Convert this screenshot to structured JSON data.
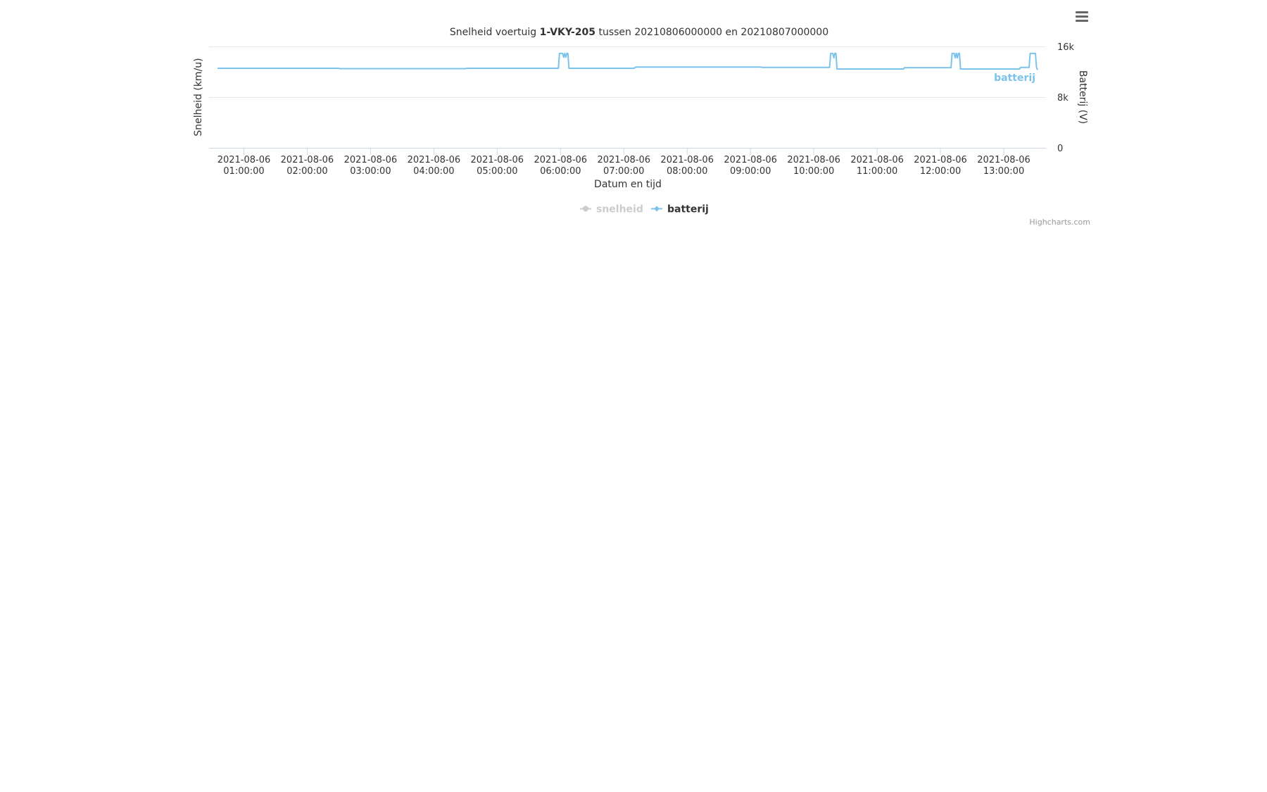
{
  "chart_data": {
    "type": "line",
    "title_prefix": "Snelheid voertuig ",
    "title_vehicle": "1-VKY-205",
    "title_suffix": " tussen 20210806000000 en 20210807000000",
    "xlabel": "Datum en tijd",
    "ylabel_left": "Snelheid (km/u)",
    "ylabel_right": "Batterij (V)",
    "x_range": [
      "2021-08-06 00:27:00",
      "2021-08-06 13:40:00"
    ],
    "x_ticks": [
      {
        "date": "2021-08-06",
        "time": "01:00:00"
      },
      {
        "date": "2021-08-06",
        "time": "02:00:00"
      },
      {
        "date": "2021-08-06",
        "time": "03:00:00"
      },
      {
        "date": "2021-08-06",
        "time": "04:00:00"
      },
      {
        "date": "2021-08-06",
        "time": "05:00:00"
      },
      {
        "date": "2021-08-06",
        "time": "06:00:00"
      },
      {
        "date": "2021-08-06",
        "time": "07:00:00"
      },
      {
        "date": "2021-08-06",
        "time": "08:00:00"
      },
      {
        "date": "2021-08-06",
        "time": "09:00:00"
      },
      {
        "date": "2021-08-06",
        "time": "10:00:00"
      },
      {
        "date": "2021-08-06",
        "time": "11:00:00"
      },
      {
        "date": "2021-08-06",
        "time": "12:00:00"
      },
      {
        "date": "2021-08-06",
        "time": "13:00:00"
      }
    ],
    "y_right": {
      "min": 0,
      "max": 16000,
      "ticks": [
        "0",
        "8k",
        "16k"
      ],
      "grid": true
    },
    "series": [
      {
        "name": "snelheid",
        "color": "#cccccc",
        "visible": false,
        "values": []
      },
      {
        "name": "batterij",
        "color": "#7cc3ec",
        "visible": true,
        "end_label": "batterij",
        "points": [
          [
            "2021-08-06 00:35:00",
            12550
          ],
          [
            "2021-08-06 02:30:00",
            12550
          ],
          [
            "2021-08-06 02:31:00",
            12500
          ],
          [
            "2021-08-06 04:30:00",
            12500
          ],
          [
            "2021-08-06 04:31:00",
            12550
          ],
          [
            "2021-08-06 05:58:00",
            12550
          ],
          [
            "2021-08-06 05:59:00",
            14900
          ],
          [
            "2021-08-06 06:02:00",
            14900
          ],
          [
            "2021-08-06 06:03:00",
            14300
          ],
          [
            "2021-08-06 06:04:00",
            14900
          ],
          [
            "2021-08-06 06:05:00",
            14300
          ],
          [
            "2021-08-06 06:06:00",
            14900
          ],
          [
            "2021-08-06 06:07:00",
            14900
          ],
          [
            "2021-08-06 06:08:00",
            12550
          ],
          [
            "2021-08-06 07:10:00",
            12550
          ],
          [
            "2021-08-06 07:11:00",
            12750
          ],
          [
            "2021-08-06 09:10:00",
            12750
          ],
          [
            "2021-08-06 09:11:00",
            12700
          ],
          [
            "2021-08-06 10:15:00",
            12700
          ],
          [
            "2021-08-06 10:16:00",
            14900
          ],
          [
            "2021-08-06 10:18:00",
            14900
          ],
          [
            "2021-08-06 10:19:00",
            14200
          ],
          [
            "2021-08-06 10:20:00",
            14900
          ],
          [
            "2021-08-06 10:21:00",
            14900
          ],
          [
            "2021-08-06 10:22:00",
            12450
          ],
          [
            "2021-08-06 11:25:00",
            12450
          ],
          [
            "2021-08-06 11:26:00",
            12650
          ],
          [
            "2021-08-06 12:10:00",
            12650
          ],
          [
            "2021-08-06 12:11:00",
            14900
          ],
          [
            "2021-08-06 12:13:00",
            14900
          ],
          [
            "2021-08-06 12:14:00",
            14200
          ],
          [
            "2021-08-06 12:15:00",
            14900
          ],
          [
            "2021-08-06 12:16:00",
            14200
          ],
          [
            "2021-08-06 12:17:00",
            14900
          ],
          [
            "2021-08-06 12:18:00",
            14900
          ],
          [
            "2021-08-06 12:19:00",
            12450
          ],
          [
            "2021-08-06 13:15:00",
            12450
          ],
          [
            "2021-08-06 13:16:00",
            12700
          ],
          [
            "2021-08-06 13:24:00",
            12700
          ],
          [
            "2021-08-06 13:25:00",
            14900
          ],
          [
            "2021-08-06 13:30:00",
            14900
          ],
          [
            "2021-08-06 13:31:00",
            12700
          ],
          [
            "2021-08-06 13:32:00",
            12300
          ]
        ]
      }
    ],
    "legend": {
      "placement": "bottom-center"
    },
    "credits": "Highcharts.com",
    "menu_icon": "hamburger-menu-icon"
  }
}
